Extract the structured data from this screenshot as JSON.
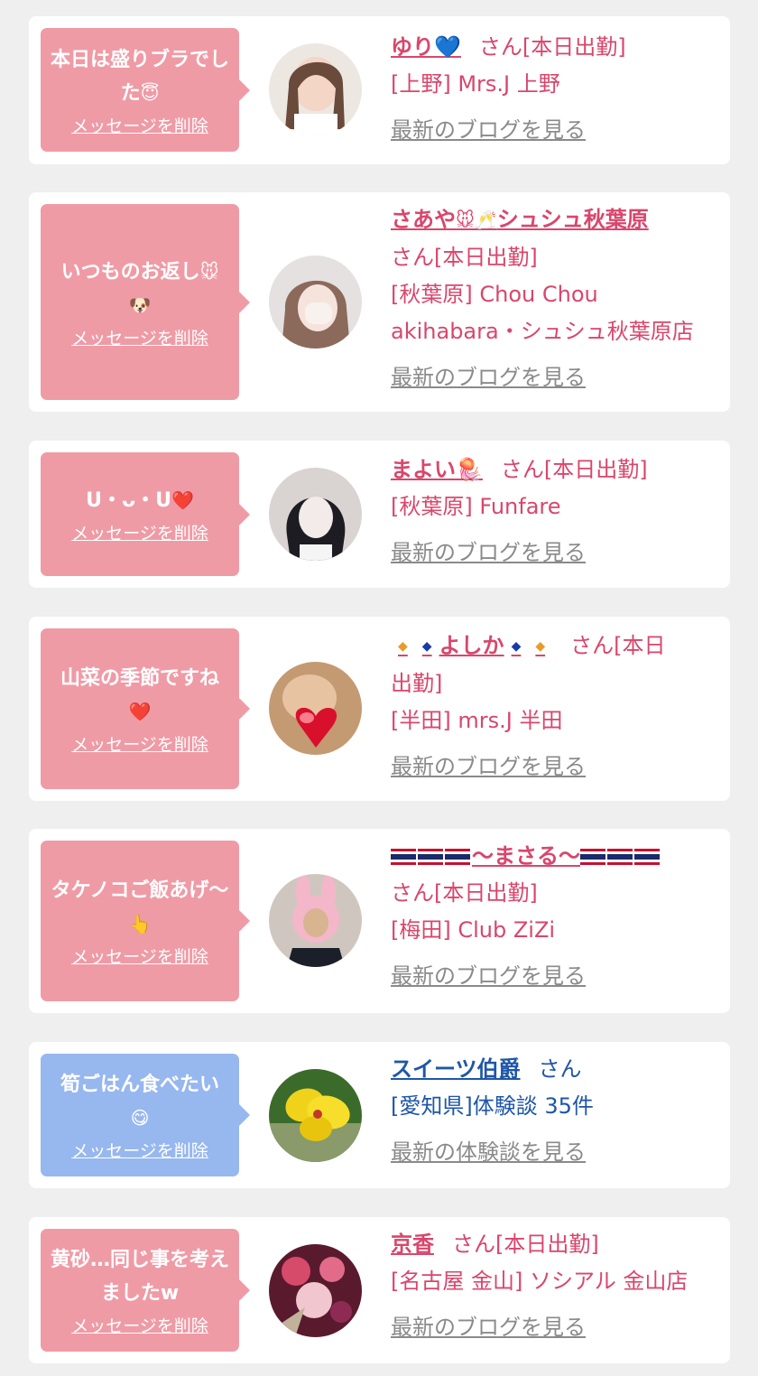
{
  "labels": {
    "delete": "メッセージを削除",
    "blog": "最新のブログを見る",
    "review": "最新の体験談を見る",
    "san_today": "さん[本日出勤]",
    "san_split1": "さん[本日",
    "san_split2": "出勤]",
    "san": "さん"
  },
  "cards": [
    {
      "msg": "本日は盛りブラでした",
      "msg_emoji": "😇",
      "name": "ゆり",
      "name_emoji": "💙",
      "shop": "[上野] Mrs.J 上野"
    },
    {
      "msg": "いつものお返し",
      "msg_emoji": "🐭",
      "msg_emoji2": "🐶",
      "name": "さあや",
      "name_emoji": "🐭🥂",
      "name_suffix": "シュシュ秋葉原",
      "shop": "[秋葉原] Chou Chou akihabara・シュシュ秋葉原店"
    },
    {
      "msg": "U・ᴗ・U",
      "msg_emoji": "❤️",
      "name": "まよい",
      "name_emoji": "🪼",
      "shop": "[秋葉原] Funfare"
    },
    {
      "msg": "山菜の季節ですね",
      "msg_emoji": "❤️",
      "name": "よしか",
      "shop": "[半田] mrs.J 半田"
    },
    {
      "msg": "タケノコご飯あげ〜",
      "msg_emoji": "👆",
      "name": "〜まさる〜",
      "shop": "[梅田] Club ZiZi"
    },
    {
      "msg": "筍ごはん食べたい",
      "msg_emoji": "😋",
      "name": "スイーツ伯爵",
      "shop": "[愛知県]体験談 35件"
    },
    {
      "msg": "黄砂…同じ事を考えましたw",
      "name": "京香",
      "shop": "[名古屋 金山] ソシアル 金山店"
    }
  ],
  "colors": {
    "bubble_pink": "#ef9ba6",
    "bubble_blue": "#97b7ef",
    "name_pink": "#d9466c",
    "name_blue": "#1e56a8",
    "link_gray": "#8a8a8a",
    "background": "#efefef"
  },
  "icons": [
    "flag-icon",
    "diamond-icon",
    "mouse-icon",
    "avatar-photo"
  ]
}
